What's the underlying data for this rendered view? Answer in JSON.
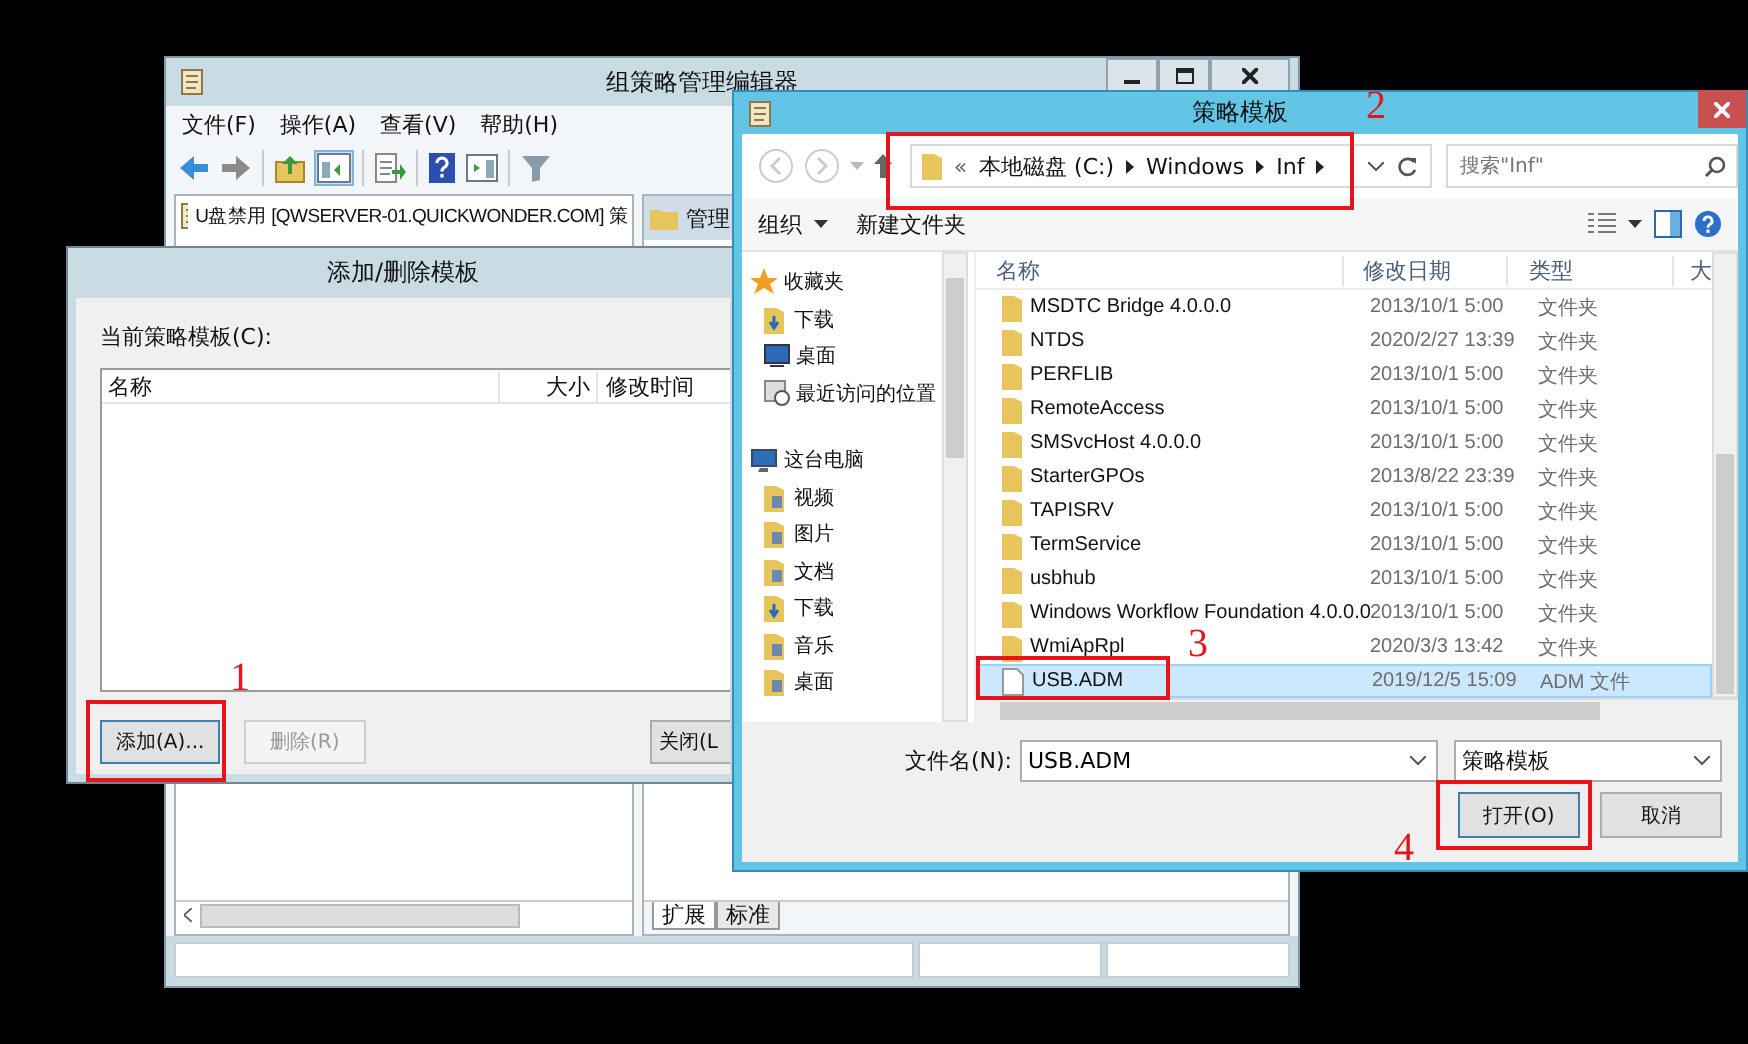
{
  "editor_window": {
    "title": "组策略管理编辑器",
    "menu": [
      "文件(F)",
      "操作(A)",
      "查看(V)",
      "帮助(H)"
    ],
    "tree_root": "U盘禁用 [QWSERVER-01.QUICKWONDER.COM] 策",
    "right_pane_heading": "管理",
    "tabs": [
      {
        "label": "扩展",
        "selected": true
      },
      {
        "label": "标准",
        "selected": false
      }
    ]
  },
  "template_dialog": {
    "title": "添加/删除模板",
    "list_label": "当前策略模板(C):",
    "columns": [
      "名称",
      "大小",
      "修改时间"
    ],
    "buttons": [
      {
        "label": "添加(A)...",
        "disabled": false
      },
      {
        "label": "删除(R)",
        "disabled": true
      },
      {
        "label": "关闭(L",
        "disabled": false
      }
    ]
  },
  "file_dialog": {
    "title": "策略模板",
    "address_prefix": "«",
    "address": [
      "本地磁盘 (C:)",
      "Windows",
      "Inf"
    ],
    "search": {
      "placeholder": "搜索\"Inf\""
    },
    "toolbar": [
      "组织",
      "新建文件夹"
    ],
    "nav": [
      {
        "label": "收藏夹",
        "kind": "favorites",
        "children": [
          {
            "label": "下载",
            "kind": "download"
          },
          {
            "label": "桌面",
            "kind": "desktop"
          },
          {
            "label": "最近访问的位置",
            "kind": "recent"
          }
        ]
      },
      {
        "label": "这台电脑",
        "kind": "computer",
        "children": [
          {
            "label": "视频",
            "kind": "folder"
          },
          {
            "label": "图片",
            "kind": "folder"
          },
          {
            "label": "文档",
            "kind": "folder"
          },
          {
            "label": "下载",
            "kind": "download"
          },
          {
            "label": "音乐",
            "kind": "folder"
          },
          {
            "label": "桌面",
            "kind": "folder"
          }
        ]
      }
    ],
    "columns": [
      "名称",
      "修改日期",
      "类型",
      "大"
    ],
    "files": [
      {
        "name": "MSDTC Bridge 4.0.0.0",
        "modified": "2013/10/1 5:00",
        "type": "文件夹",
        "kind": "folder",
        "selected": false
      },
      {
        "name": "NTDS",
        "modified": "2020/2/27 13:39",
        "type": "文件夹",
        "kind": "folder",
        "selected": false
      },
      {
        "name": "PERFLIB",
        "modified": "2013/10/1 5:00",
        "type": "文件夹",
        "kind": "folder",
        "selected": false
      },
      {
        "name": "RemoteAccess",
        "modified": "2013/10/1 5:00",
        "type": "文件夹",
        "kind": "folder",
        "selected": false
      },
      {
        "name": "SMSvcHost 4.0.0.0",
        "modified": "2013/10/1 5:00",
        "type": "文件夹",
        "kind": "folder",
        "selected": false
      },
      {
        "name": "StarterGPOs",
        "modified": "2013/8/22 23:39",
        "type": "文件夹",
        "kind": "folder",
        "selected": false
      },
      {
        "name": "TAPISRV",
        "modified": "2013/10/1 5:00",
        "type": "文件夹",
        "kind": "folder",
        "selected": false
      },
      {
        "name": "TermService",
        "modified": "2013/10/1 5:00",
        "type": "文件夹",
        "kind": "folder",
        "selected": false
      },
      {
        "name": "usbhub",
        "modified": "2013/10/1 5:00",
        "type": "文件夹",
        "kind": "folder",
        "selected": false
      },
      {
        "name": "Windows Workflow Foundation 4.0.0.0",
        "modified": "2013/10/1 5:00",
        "type": "文件夹",
        "kind": "folder",
        "selected": false
      },
      {
        "name": "WmiApRpl",
        "modified": "2020/3/3 13:42",
        "type": "文件夹",
        "kind": "folder",
        "selected": false
      },
      {
        "name": "USB.ADM",
        "modified": "2019/12/5 15:09",
        "type": "ADM 文件",
        "kind": "file",
        "selected": true
      }
    ],
    "filename_label": "文件名(N):",
    "filename": "USB.ADM",
    "filetype": "策略模板",
    "buttons": [
      "打开(O)",
      "取消"
    ]
  },
  "annotations": [
    {
      "label": "1"
    },
    {
      "label": "2"
    },
    {
      "label": "3"
    },
    {
      "label": "4"
    }
  ]
}
